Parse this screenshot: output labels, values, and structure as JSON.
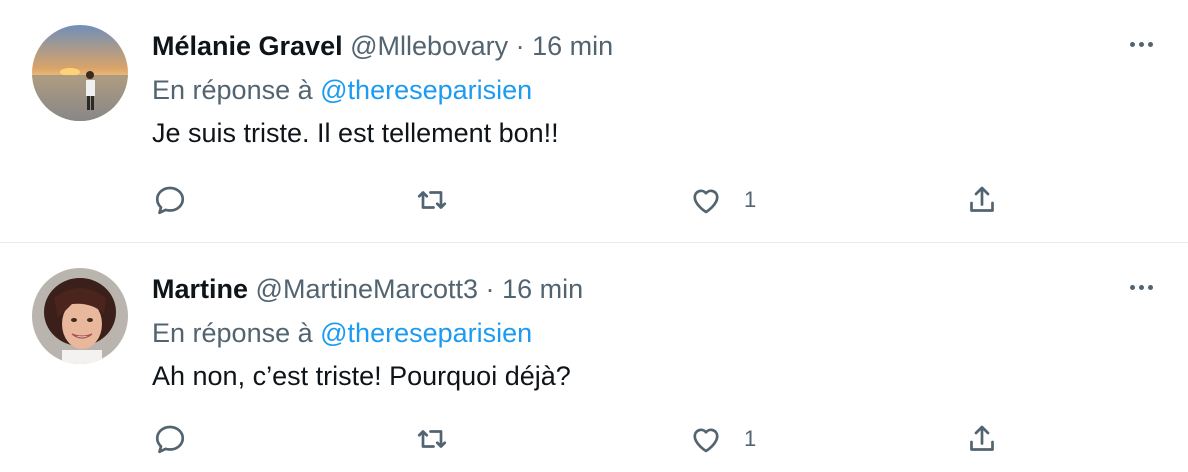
{
  "tweets": [
    {
      "name": "Mélanie Gravel",
      "handle": "@Mllebovary",
      "separator": "·",
      "time": "16 min",
      "reply_prefix": "En réponse à",
      "reply_mention": "@thereseparisien",
      "text": "Je suis triste. Il est tellement bon!!",
      "like_count": "1"
    },
    {
      "name": "Martine",
      "handle": "@MartineMarcott3",
      "separator": "·",
      "time": "16 min",
      "reply_prefix": "En réponse à",
      "reply_mention": "@thereseparisien",
      "text": "Ah non, c’est triste! Pourquoi déjà?",
      "like_count": "1"
    }
  ],
  "icons": [
    "reply-icon",
    "retweet-icon",
    "like-icon",
    "share-icon",
    "more-icon"
  ],
  "colors": {
    "text": "#0f1419",
    "secondary": "#536471",
    "link": "#1d9bf0",
    "divider": "#e6ecf0"
  }
}
